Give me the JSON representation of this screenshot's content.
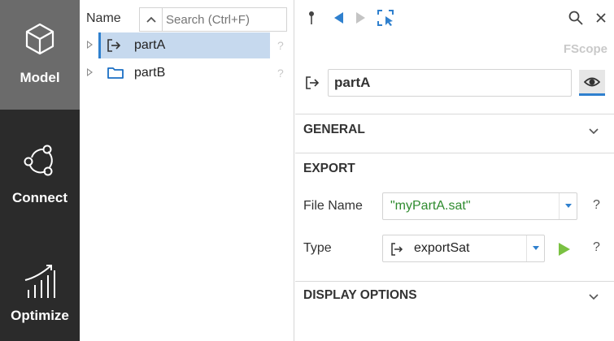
{
  "sidebar": {
    "items": [
      {
        "label": "Model",
        "icon": "cube-icon",
        "active": true
      },
      {
        "label": "Connect",
        "icon": "connect-icon"
      },
      {
        "label": "Optimize",
        "icon": "chart-icon"
      }
    ]
  },
  "tree": {
    "header_label": "Name",
    "search_placeholder": "Search (Ctrl+F)",
    "rows": [
      {
        "label": "partA",
        "icon": "export-icon",
        "selected": true,
        "help": "?"
      },
      {
        "label": "partB",
        "icon": "folder-icon",
        "selected": false,
        "help": "?"
      }
    ]
  },
  "props": {
    "scope_label": "FScope",
    "object_name": "partA",
    "sections": {
      "general": "GENERAL",
      "export": "EXPORT",
      "display": "DISPLAY OPTIONS"
    },
    "fields": {
      "file_name_label": "File Name",
      "file_name_value": "\"myPartA.sat\"",
      "type_label": "Type",
      "type_value": "exportSat",
      "help": "?"
    }
  },
  "colors": {
    "sidebar_bg": "#2b2b2b",
    "sidebar_active": "#6b6b6b",
    "accent_blue": "#2f80ce",
    "selection": "#c6d9ee",
    "string_green": "#2e8b2e",
    "run_green": "#7ac142"
  }
}
